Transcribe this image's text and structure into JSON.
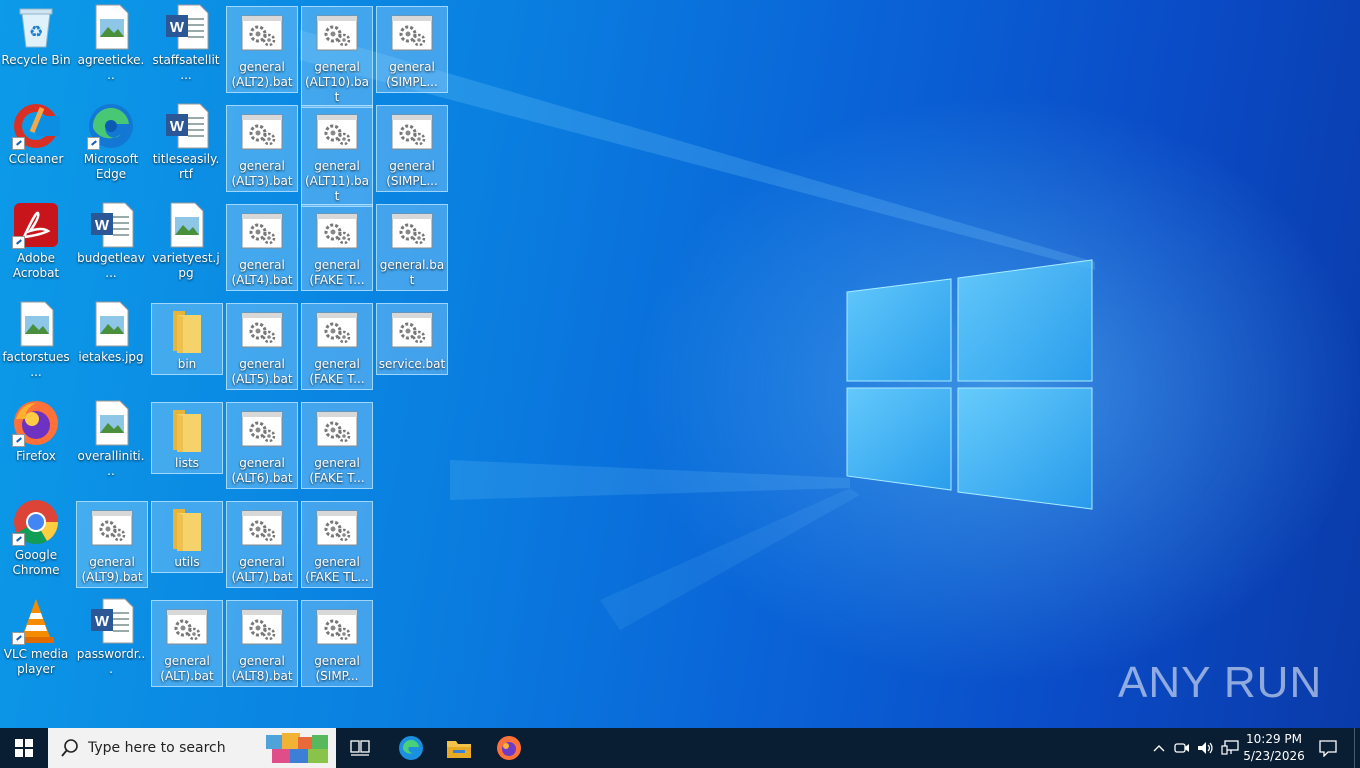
{
  "desktop": {
    "icons": [
      {
        "label": "Recycle Bin",
        "kind": "recycle-bin"
      },
      {
        "label": "agreeticke...",
        "kind": "image"
      },
      {
        "label": "staffsatellit...",
        "kind": "word"
      },
      {
        "label": "general (ALT2).bat",
        "kind": "bat"
      },
      {
        "label": "general (ALT10).bat",
        "kind": "bat"
      },
      {
        "label": "general (SIMPL...",
        "kind": "bat"
      },
      {
        "label": "CCleaner",
        "kind": "ccleaner"
      },
      {
        "label": "Microsoft Edge",
        "kind": "edge"
      },
      {
        "label": "titleseasily.rtf",
        "kind": "word"
      },
      {
        "label": "general (ALT3).bat",
        "kind": "bat"
      },
      {
        "label": "general (ALT11).bat",
        "kind": "bat"
      },
      {
        "label": "general (SIMPL...",
        "kind": "bat"
      },
      {
        "label": "Adobe Acrobat",
        "kind": "acrobat"
      },
      {
        "label": "budgetleav...",
        "kind": "word"
      },
      {
        "label": "varietyest.jpg",
        "kind": "image"
      },
      {
        "label": "general (ALT4).bat",
        "kind": "bat"
      },
      {
        "label": "general (FAKE T...",
        "kind": "bat"
      },
      {
        "label": "general.bat",
        "kind": "bat"
      },
      {
        "label": "factorstues...",
        "kind": "image"
      },
      {
        "label": "ietakes.jpg",
        "kind": "image"
      },
      {
        "label": "bin",
        "kind": "folder"
      },
      {
        "label": "general (ALT5).bat",
        "kind": "bat"
      },
      {
        "label": "general (FAKE T...",
        "kind": "bat"
      },
      {
        "label": "service.bat",
        "kind": "bat"
      },
      {
        "label": "Firefox",
        "kind": "firefox"
      },
      {
        "label": "overalliniti...",
        "kind": "image"
      },
      {
        "label": "lists",
        "kind": "folder"
      },
      {
        "label": "general (ALT6).bat",
        "kind": "bat"
      },
      {
        "label": "general (FAKE T...",
        "kind": "bat"
      },
      {
        "label": "Google Chrome",
        "kind": "chrome"
      },
      {
        "label": "general (ALT9).bat",
        "kind": "bat"
      },
      {
        "label": "utils",
        "kind": "folder"
      },
      {
        "label": "general (ALT7).bat",
        "kind": "bat"
      },
      {
        "label": "general (FAKE TL...",
        "kind": "bat"
      },
      {
        "label": "VLC media player",
        "kind": "vlc"
      },
      {
        "label": "passwordr...",
        "kind": "word"
      },
      {
        "label": "general (ALT).bat",
        "kind": "bat"
      },
      {
        "label": "general (ALT8).bat",
        "kind": "bat"
      },
      {
        "label": "general (SIMP...",
        "kind": "bat"
      }
    ]
  },
  "watermark": "ANY RUN",
  "taskbar": {
    "search_placeholder": "Type here to search",
    "apps": [
      "task-view-icon",
      "edge-icon",
      "file-explorer-icon",
      "firefox-icon"
    ],
    "clock_time": "10:29 PM",
    "clock_date": "5/23/2026"
  },
  "colors": {
    "taskbar": "#0a1e33",
    "desktop_accent": "#0a7fe0",
    "selection": "#a0d7ff"
  }
}
